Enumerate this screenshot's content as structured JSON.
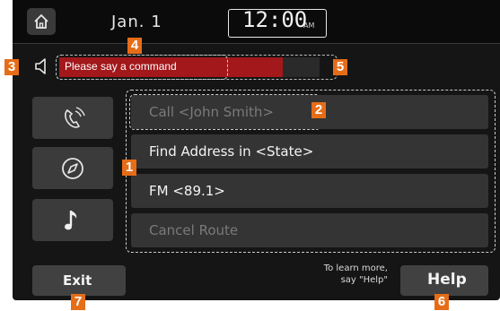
{
  "header": {
    "home_icon": "home-icon",
    "date": "Jan.  1",
    "time": "12:00",
    "ampm": "AM"
  },
  "voice": {
    "speaker_icon": "speaker-icon",
    "prompt": "Please say a command",
    "level": 0.86,
    "level_color": "#a2181b"
  },
  "sidebar": {
    "items": [
      {
        "icon": "phone-voice-icon"
      },
      {
        "icon": "compass-icon"
      },
      {
        "icon": "music-note-icon"
      }
    ]
  },
  "options": [
    {
      "label": "Call <John Smith>",
      "enabled": false
    },
    {
      "label": "Find Address in <State>",
      "enabled": true
    },
    {
      "label": "FM <89.1>",
      "enabled": true
    },
    {
      "label": "Cancel Route",
      "enabled": false
    }
  ],
  "footer": {
    "exit_label": "Exit",
    "hint_line1": "To learn more,",
    "hint_line2": "say \"Help\"",
    "help_label": "Help"
  },
  "callouts": [
    "1",
    "2",
    "3",
    "4",
    "5",
    "6",
    "7"
  ],
  "colors": {
    "callout": "#e56d18",
    "background": "#151515"
  }
}
